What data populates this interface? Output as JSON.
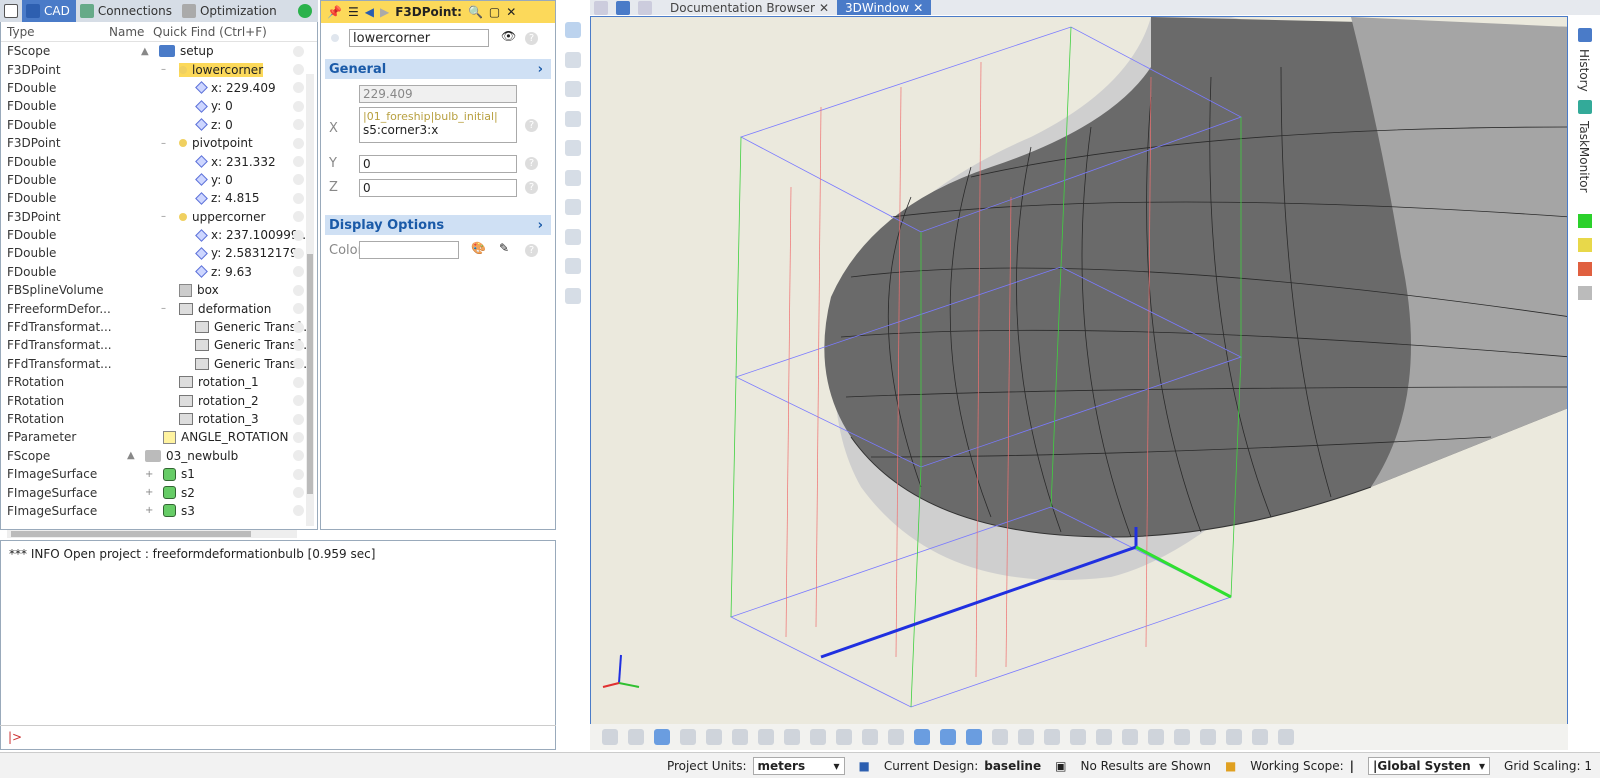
{
  "tabs": [
    {
      "label": "CAD",
      "active": true
    },
    {
      "label": "Connections"
    },
    {
      "label": "Optimization"
    }
  ],
  "tree": {
    "header": {
      "type": "Type",
      "name": "Name",
      "quickfind": "Quick Find (Ctrl+F)"
    },
    "rows": [
      {
        "type": "FScope",
        "name": "setup",
        "icon": "folder-icon",
        "indent": 158,
        "exp": "▲"
      },
      {
        "type": "F3DPoint",
        "name": "lowercorner",
        "icon": "point-icon",
        "indent": 178,
        "exp": "–",
        "selected": true
      },
      {
        "type": "FDouble",
        "name": "x: 229.409",
        "icon": "double-icon",
        "indent": 196
      },
      {
        "type": "FDouble",
        "name": "y: 0",
        "icon": "double-icon",
        "indent": 196
      },
      {
        "type": "FDouble",
        "name": "z: 0",
        "icon": "double-icon",
        "indent": 196
      },
      {
        "type": "F3DPoint",
        "name": "pivotpoint",
        "icon": "point-icon",
        "indent": 178,
        "exp": "–"
      },
      {
        "type": "FDouble",
        "name": "x: 231.332",
        "icon": "double-icon",
        "indent": 196
      },
      {
        "type": "FDouble",
        "name": "y: 0",
        "icon": "double-icon",
        "indent": 196
      },
      {
        "type": "FDouble",
        "name": "z: 4.815",
        "icon": "double-icon",
        "indent": 196
      },
      {
        "type": "F3DPoint",
        "name": "uppercorner",
        "icon": "point-icon",
        "indent": 178,
        "exp": "–"
      },
      {
        "type": "FDouble",
        "name": "x: 237.100999...",
        "icon": "double-icon",
        "indent": 196
      },
      {
        "type": "FDouble",
        "name": "y: 2.58312179",
        "icon": "double-icon",
        "indent": 196
      },
      {
        "type": "FDouble",
        "name": "z: 9.63",
        "icon": "double-icon",
        "indent": 196
      },
      {
        "type": "FBSplineVolume",
        "name": "box",
        "icon": "box-icon",
        "indent": 178
      },
      {
        "type": "FFreeformDefor...",
        "name": "deformation",
        "icon": "history-icon",
        "indent": 178,
        "exp": "–"
      },
      {
        "type": "FFdTransformat...",
        "name": "Generic Transf...",
        "icon": "history-icon",
        "indent": 194
      },
      {
        "type": "FFdTransformat...",
        "name": "Generic Transf...",
        "icon": "history-icon",
        "indent": 194
      },
      {
        "type": "FFdTransformat...",
        "name": "Generic Transf...",
        "icon": "history-icon",
        "indent": 194
      },
      {
        "type": "FRotation",
        "name": "rotation_1",
        "icon": "history-icon",
        "indent": 178
      },
      {
        "type": "FRotation",
        "name": "rotation_2",
        "icon": "history-icon",
        "indent": 178
      },
      {
        "type": "FRotation",
        "name": "rotation_3",
        "icon": "history-icon",
        "indent": 178
      },
      {
        "type": "FParameter",
        "name": "ANGLE_ROTATION",
        "icon": "param-icon",
        "indent": 162
      },
      {
        "type": "FScope",
        "name": "03_newbulb",
        "icon": "folder-gray-icon",
        "indent": 144,
        "exp": "▲"
      },
      {
        "type": "FImageSurface",
        "name": "s1",
        "icon": "surface-icon",
        "indent": 162,
        "exp": "+"
      },
      {
        "type": "FImageSurface",
        "name": "s2",
        "icon": "surface-icon",
        "indent": 162,
        "exp": "+"
      },
      {
        "type": "FImageSurface",
        "name": "s3",
        "icon": "surface-icon",
        "indent": 162,
        "exp": "+"
      }
    ]
  },
  "props": {
    "toolbar_title": "F3DPoint:",
    "name": "lowercorner",
    "general": "General",
    "x_label": "X",
    "x_value": "229.409",
    "x_expr_1": "|01_foreship|bulb_initial|",
    "x_expr_2": "s5:corner3:x",
    "y_label": "Y",
    "y_value": "0",
    "z_label": "Z",
    "z_value": "0",
    "display": "Display Options",
    "color_label": "Color"
  },
  "console": {
    "line": "*** INFO Open project : freeformdeformationbulb [0.959 sec]",
    "prompt": "|>"
  },
  "viewtabs": [
    {
      "label": "Documentation Browser"
    },
    {
      "label": "3DWindow",
      "active": true
    }
  ],
  "rightbar": {
    "history": "History",
    "taskmonitor": "TaskMonitor"
  },
  "status": {
    "units_label": "Project Units:",
    "units": "meters",
    "design_label": "Current Design:",
    "design": "baseline",
    "results": "No Results are Shown",
    "scope_label": "Working Scope:",
    "scope": "|",
    "system": "|Global Systen",
    "grid": "Grid Scaling: 1"
  },
  "colors": {
    "accent": "#4a7bc8",
    "selection": "#fcd95a",
    "viewport_bg": "#ebe9dd"
  }
}
